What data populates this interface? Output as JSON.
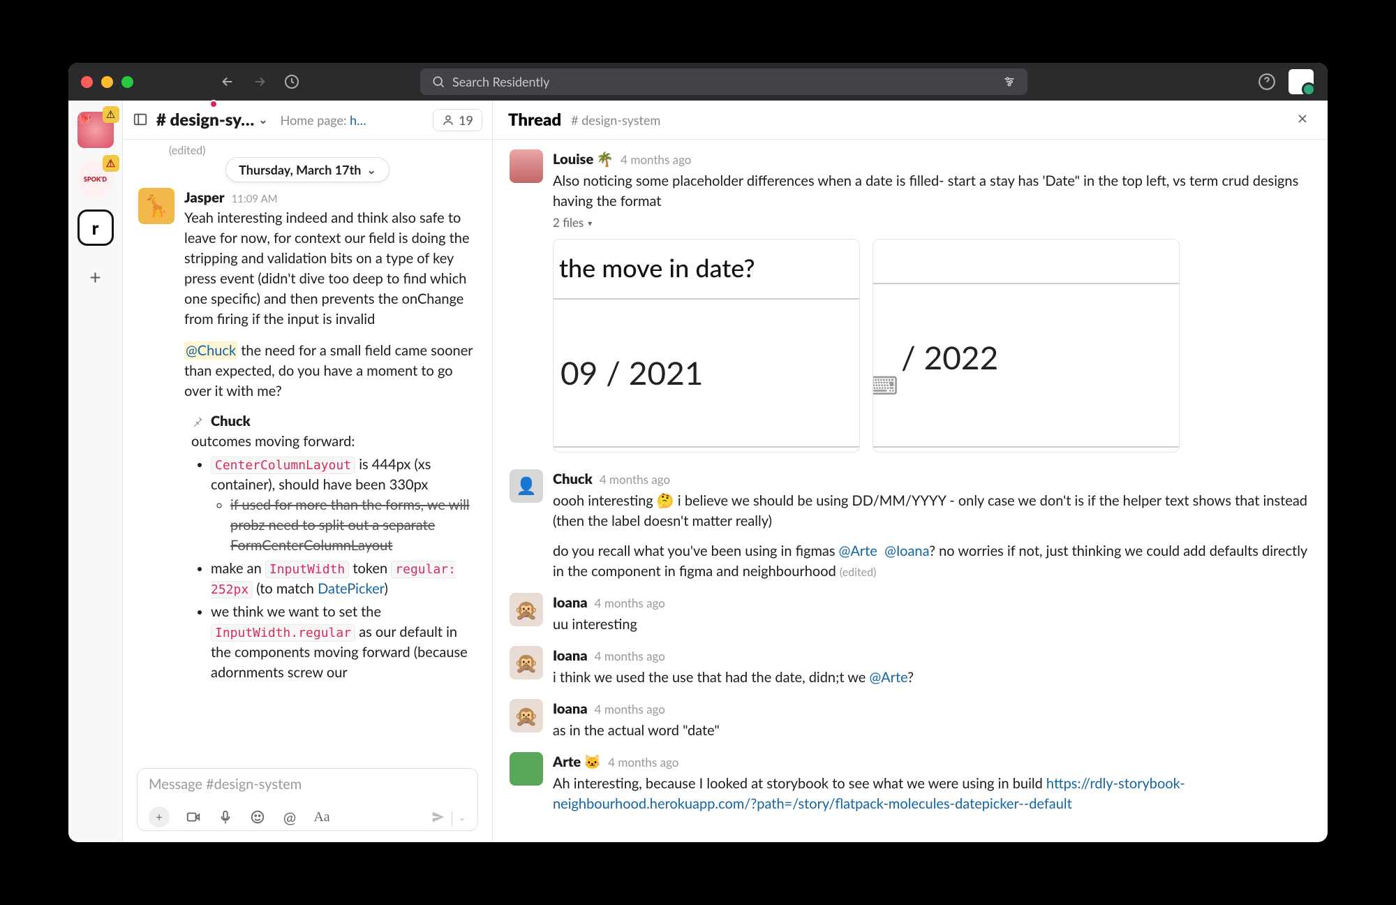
{
  "titlebar": {
    "search_placeholder": "Search Residently"
  },
  "workspaces": {
    "ws2_label": "SPOK'D"
  },
  "channel": {
    "name": "# design-sy…",
    "home_prefix": "Home page: ",
    "home_link": "h…",
    "members": "19",
    "date_divider": "Thursday, March 17th",
    "edited_tag": "(edited)",
    "msg1": {
      "from": "Jasper",
      "time": "11:09 AM",
      "para1": "Yeah interesting indeed and think also safe to leave for now, for context our field is doing the stripping and validation bits on a type of key press event (didn't dive too deep to find which one specific) and then prevents the onChange from firing if the input is invalid",
      "mention": "@Chuck",
      "para2_rest": " the need for a small field came sooner than expected, do you have a moment to go over it with me?"
    },
    "pinned": {
      "from": "Chuck",
      "intro": "outcomes moving forward:",
      "b1_code": "CenterColumnLayout",
      "b1_rest": " is 444px (xs container), should have been 330px",
      "b1_sub": "if used for more than the forms, we will probz need to split out a separate FormCenterColumnLayout",
      "b2_pre": "make an ",
      "b2_code": "InputWidth",
      "b2_mid": " token ",
      "b2_code2": "regular: 252px",
      "b2_post": " (to match ",
      "b2_link": "DatePicker",
      "b2_close": ")",
      "b3_pre": "we think we want to set the ",
      "b3_code": "InputWidth.regular",
      "b3_post": " as our default in the components moving forward (because adornments screw our"
    },
    "composer_placeholder": "Message #design-system"
  },
  "thread": {
    "title": "Thread",
    "sub": "# design-system",
    "r1": {
      "from": "Louise",
      "time": "4 months ago",
      "body": "Also noticing some placeholder differences when a date is filled- start a stay has 'Date\" in the top left,  vs term crud designs having the format",
      "files": "2 files",
      "attach1_q": "the move in date?",
      "attach1_val": "09 / 2021",
      "attach2_val": "/ 2022"
    },
    "r2": {
      "from": "Chuck",
      "time": "4 months ago",
      "p1a": "oooh interesting ",
      "p1b": " i believe we should be using DD/MM/YYYY - only case we don't is if the helper text shows that instead (then the label doesn't matter really)",
      "p2a": "do you recall what you've been using in figmas ",
      "m1": "@Arte",
      "m2": "@Ioana",
      "p2b": "? no worries if not, just thinking we could add defaults directly in the component in figma and neighbourhood ",
      "edited": "(edited)"
    },
    "r3": {
      "from": "Ioana",
      "time": "4 months ago",
      "body": "uu interesting"
    },
    "r4": {
      "from": "Ioana",
      "time": "4 months ago",
      "body_a": "i think we used the use that had the date, didn;t we ",
      "mention": "@Arte",
      "body_b": "?"
    },
    "r5": {
      "from": "Ioana",
      "time": "4 months ago",
      "body": "as in the actual word \"date\""
    },
    "r6": {
      "from": "Arte",
      "time": "4 months ago",
      "body": "Ah interesting, because I looked at storybook to see what we were using in build ",
      "link": "https://rdly-storybook-neighbourhood.herokuapp.com/?path=/story/flatpack-molecules-datepicker--default"
    }
  }
}
